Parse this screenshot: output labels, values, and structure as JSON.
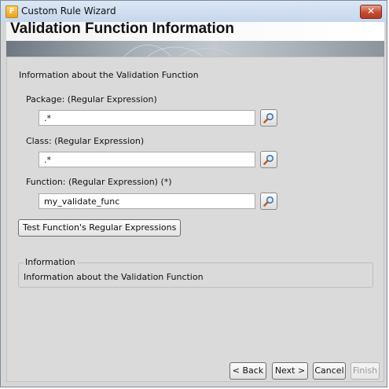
{
  "window": {
    "title": "Custom Rule Wizard",
    "app_icon_letter": "F",
    "close_glyph": "✕"
  },
  "banner": {
    "heading": "Validation Function Information"
  },
  "form": {
    "section_label": "Information about the Validation Function",
    "package": {
      "label": "Package: (Regular Expression)",
      "value": ".*"
    },
    "class": {
      "label": "Class: (Regular Expression)",
      "value": ".*"
    },
    "function": {
      "label": "Function: (Regular Expression) (*)",
      "value": "my_validate_func"
    },
    "browse_icon": "magnifier-icon",
    "test_button": "Test Function's Regular Expressions"
  },
  "info": {
    "title": "Information",
    "text": "Information about the Validation Function"
  },
  "buttons": {
    "back": "< Back",
    "next": "Next >",
    "cancel": "Cancel",
    "finish": "Finish"
  },
  "colors": {
    "window_bg": "#d6d6d6",
    "titlebar": "#c6d7ec",
    "close_button": "#c44b2f"
  }
}
